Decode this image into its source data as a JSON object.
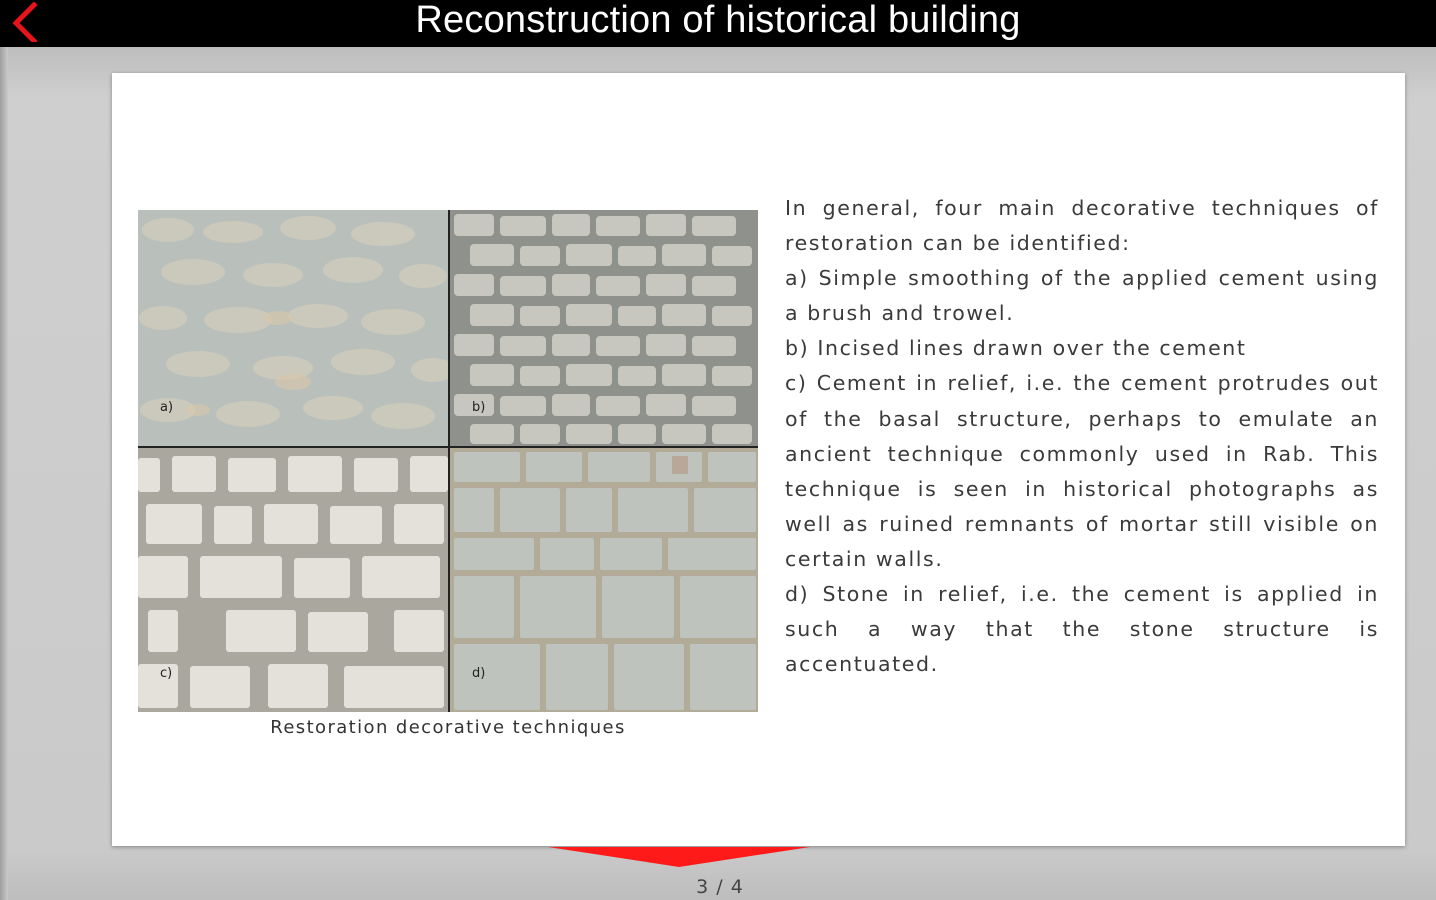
{
  "header": {
    "title": "Reconstruction of historical building",
    "back_icon": "chevron-left-icon",
    "accent_color": "#e8141b"
  },
  "page": {
    "figure": {
      "panels": [
        {
          "label": "a)"
        },
        {
          "label": "b)"
        },
        {
          "label": "c)"
        },
        {
          "label": "d)"
        }
      ],
      "caption": "Restoration decorative techniques"
    },
    "paragraphs": [
      "In general, four main decorative techniques of restoration can be identified:",
      "a) Simple smoothing of the applied cement using a brush and trowel.",
      "b) Incised lines drawn over the cement",
      "c) Cement in relief, i.e. the cement protrudes out of the basal structure, perhaps to emulate an ancient technique commonly used in Rab. This technique is seen in historical photographs as well as ruined remnants of mortar still visible on certain walls.",
      "d) Stone in relief, i.e. the cement is applied in such a way that the stone structure is accentuated."
    ]
  },
  "pagination": {
    "current": 3,
    "total": 4,
    "label": "3 / 4",
    "indicator_color": "#ff1a1a"
  }
}
